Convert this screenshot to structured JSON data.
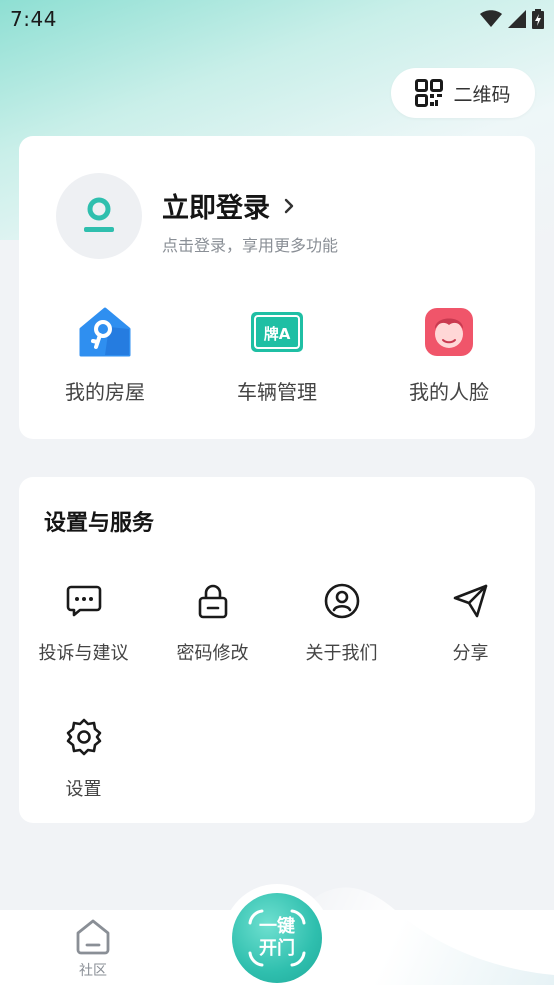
{
  "status_bar": {
    "time": "7:44"
  },
  "qr_button": {
    "label": "二维码"
  },
  "profile": {
    "login_title": "立即登录",
    "login_subtitle": "点击登录，享用更多功能"
  },
  "quick_actions": [
    {
      "label": "我的房屋",
      "icon": "house-key-icon"
    },
    {
      "label": "车辆管理",
      "icon": "license-plate-icon"
    },
    {
      "label": "我的人脸",
      "icon": "face-icon"
    }
  ],
  "services": {
    "title": "设置与服务",
    "items": [
      {
        "label": "投诉与建议",
        "icon": "chat-bubble-icon"
      },
      {
        "label": "密码修改",
        "icon": "lock-icon"
      },
      {
        "label": "关于我们",
        "icon": "user-circle-icon"
      },
      {
        "label": "分享",
        "icon": "send-icon"
      },
      {
        "label": "设置",
        "icon": "gear-icon"
      }
    ]
  },
  "plate_text": "牌A",
  "bottom_nav": {
    "community_label": "社区",
    "open_door_line1": "一键",
    "open_door_line2": "开门"
  },
  "colors": {
    "accent": "#2fbfae",
    "gradient_start": "#8edfd3",
    "house_blue": "#2f8ff0",
    "face_red": "#f0556a"
  }
}
